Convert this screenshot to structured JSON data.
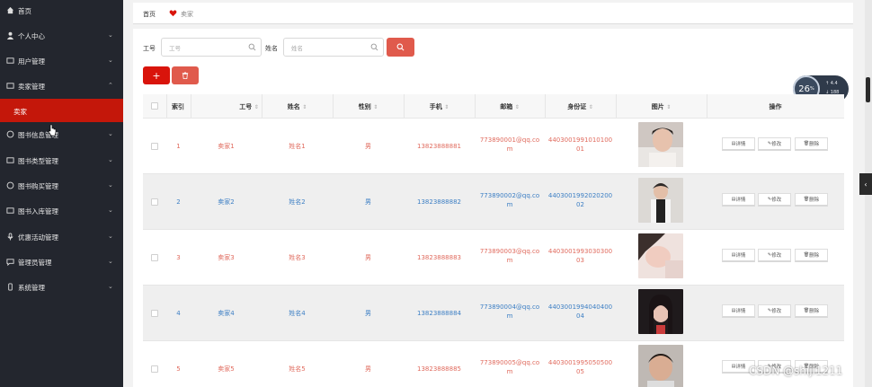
{
  "sidebar": {
    "items": [
      {
        "label": "首页",
        "icon": "home-icon",
        "expanded": false
      },
      {
        "label": "个人中心",
        "icon": "user-icon",
        "expanded": false
      },
      {
        "label": "用户管理",
        "icon": "folder-icon",
        "expanded": false
      },
      {
        "label": "卖家管理",
        "icon": "folder-icon",
        "expanded": true
      },
      {
        "label": "图书信息管理",
        "icon": "globe-icon",
        "expanded": false
      },
      {
        "label": "图书类型管理",
        "icon": "folder-icon",
        "expanded": false
      },
      {
        "label": "图书购买管理",
        "icon": "globe-icon",
        "expanded": false
      },
      {
        "label": "图书入库管理",
        "icon": "folder-icon",
        "expanded": false
      },
      {
        "label": "优惠活动管理",
        "icon": "mic-icon",
        "expanded": false
      },
      {
        "label": "管理员管理",
        "icon": "chat-icon",
        "expanded": false
      },
      {
        "label": "系统管理",
        "icon": "mobile-icon",
        "expanded": false
      }
    ],
    "active_sub": "卖家",
    "colors": {
      "bg": "#23262e",
      "active": "#c4170a"
    }
  },
  "breadcrumb": {
    "home": "首页",
    "current": "卖家"
  },
  "filters": {
    "worker_no_label": "工号",
    "worker_no_placeholder": "工号",
    "name_label": "姓名",
    "name_placeholder": "姓名"
  },
  "stat_widget": {
    "value": "26",
    "unit": "%",
    "line1": "4.4",
    "line2": "188"
  },
  "table": {
    "columns": [
      "索引",
      "工号",
      "姓名",
      "性别",
      "手机",
      "邮箱",
      "身份证",
      "图片",
      "操作"
    ],
    "rows": [
      {
        "index": "1",
        "worker_no": "卖家1",
        "name": "姓名1",
        "gender": "男",
        "phone": "13823888881",
        "email_a": "773890001@qq.co",
        "email_b": "m",
        "id_a": "4403001991010100",
        "id_b": "01",
        "photo": "photo-1",
        "accent": "#e06b5e"
      },
      {
        "index": "2",
        "worker_no": "卖家2",
        "name": "姓名2",
        "gender": "男",
        "phone": "13823888882",
        "email_a": "773890002@qq.co",
        "email_b": "m",
        "id_a": "4403001992020200",
        "id_b": "02",
        "photo": "photo-2",
        "accent": "#3d7fc4"
      },
      {
        "index": "3",
        "worker_no": "卖家3",
        "name": "姓名3",
        "gender": "男",
        "phone": "13823888883",
        "email_a": "773890003@qq.co",
        "email_b": "m",
        "id_a": "4403001993030300",
        "id_b": "03",
        "photo": "photo-3",
        "accent": "#e06b5e"
      },
      {
        "index": "4",
        "worker_no": "卖家4",
        "name": "姓名4",
        "gender": "男",
        "phone": "13823888884",
        "email_a": "773890004@qq.co",
        "email_b": "m",
        "id_a": "4403001994040400",
        "id_b": "04",
        "photo": "photo-4",
        "accent": "#3d7fc4"
      },
      {
        "index": "5",
        "worker_no": "卖家5",
        "name": "姓名5",
        "gender": "男",
        "phone": "13823888885",
        "email_a": "773890005@qq.co",
        "email_b": "m",
        "id_a": "4403001995050500",
        "id_b": "05",
        "photo": "photo-5",
        "accent": "#e06b5e"
      }
    ],
    "actions": {
      "detail": "详情",
      "edit": "修改",
      "delete": "删除"
    }
  },
  "watermark": "CSDN @shiji1211",
  "colors": {
    "primary_red": "#d9140b",
    "soft_red": "#e05a4c",
    "blue_text": "#3d7fc4",
    "red_text": "#e06b5e"
  }
}
